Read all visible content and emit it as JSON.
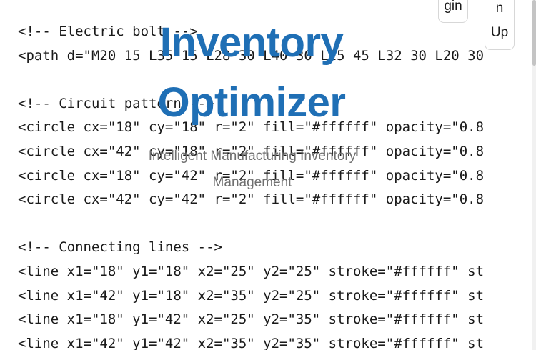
{
  "code": {
    "lines": [
      "<!-- Electric bolt -->",
      "<path d=\"M20 15 L35 15 L28 30 L40 30 L25 45 L32 30 L20 30",
      "",
      "<!-- Circuit pattern -->",
      "<circle cx=\"18\" cy=\"18\" r=\"2\" fill=\"#ffffff\" opacity=\"0.8",
      "<circle cx=\"42\" cy=\"18\" r=\"2\" fill=\"#ffffff\" opacity=\"0.8",
      "<circle cx=\"18\" cy=\"42\" r=\"2\" fill=\"#ffffff\" opacity=\"0.8",
      "<circle cx=\"42\" cy=\"42\" r=\"2\" fill=\"#ffffff\" opacity=\"0.8",
      "",
      "<!-- Connecting lines -->",
      "<line x1=\"18\" y1=\"18\" x2=\"25\" y2=\"25\" stroke=\"#ffffff\" st",
      "<line x1=\"42\" y1=\"18\" x2=\"35\" y2=\"25\" stroke=\"#ffffff\" st",
      "<line x1=\"18\" y1=\"42\" x2=\"25\" y2=\"35\" stroke=\"#ffffff\" st",
      "<line x1=\"42\" y1=\"42\" x2=\"35\" y2=\"35\" stroke=\"#ffffff\" st"
    ]
  },
  "hero": {
    "title": "Inventory Optimizer",
    "subtitle": "Intelligent Manufacturing Inventory Management"
  },
  "nav": {
    "login_label": "gin",
    "signup_label_top": "n",
    "signup_label_bottom": "Up"
  },
  "colors": {
    "title": "#1f6fb5",
    "subtitle": "#6f6f6f",
    "code_text": "#1a1a1a",
    "background": "#ffffff"
  }
}
